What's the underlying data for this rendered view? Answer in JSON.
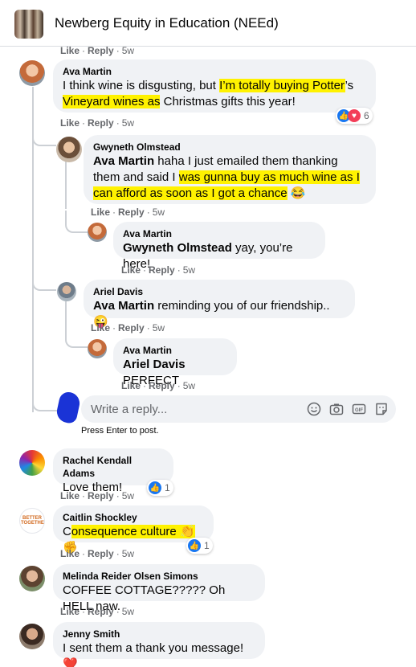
{
  "header": {
    "title": "Newberg Equity in Education (NEEd)"
  },
  "top_actions": {
    "like": "Like",
    "reply": "Reply",
    "time": "5w"
  },
  "comments": [
    {
      "author": "Ava Martin",
      "text_parts": [
        "I think wine is disgusting, but ",
        "I’m totally buying Potter",
        "’s ",
        "Vineyard wines as",
        " Christmas gifts this year!"
      ],
      "like": "Like",
      "reply": "Reply",
      "time": "5w",
      "reaction_count": "6"
    },
    {
      "author": "Gwyneth Olmstead",
      "mention": "Ava Martin",
      "text_parts": [
        " haha I just emailed them thanking them and said I ",
        "was gunna buy as much wine as I can afford as soon as I got a chance",
        " 😂"
      ],
      "like": "Like",
      "reply": "Reply",
      "time": "5w"
    },
    {
      "author": "Ava Martin",
      "mention": "Gwyneth Olmstead",
      "text": " yay, you’re here!",
      "like": "Like",
      "reply": "Reply",
      "time": "5w"
    },
    {
      "author": "Ariel Davis",
      "mention": "Ava Martin",
      "text": " reminding you of our friendship.. 😜",
      "like": "Like",
      "reply": "Reply",
      "time": "5w"
    },
    {
      "author": "Ava Martin",
      "mention": "Ariel Davis",
      "text": " PERFECT",
      "like": "Like",
      "reply": "Reply",
      "time": "5w"
    },
    {
      "author": "Rachel Kendall Adams",
      "text": "Love them!",
      "like": "Like",
      "reply": "Reply",
      "time": "5w",
      "reaction_count": "1"
    },
    {
      "author": "Caitlin Shockley",
      "text_parts": [
        "C",
        "onsequence culture 👏",
        "✊"
      ],
      "like": "Like",
      "reply": "Reply",
      "time": "5w",
      "reaction_count": "1",
      "avatar_text": "BETTER TOGETHER"
    },
    {
      "author": "Melinda Reider Olsen Simons",
      "text": "COFFEE COTTAGE????? Oh HELL naw.",
      "like": "Like",
      "reply": "Reply",
      "time": "5w"
    },
    {
      "author": "Jenny Smith",
      "text": "I sent them a thank you message! ❤️"
    }
  ],
  "reply_box": {
    "placeholder": "Write a reply...",
    "hint": "Press Enter to post."
  },
  "icons": [
    "emoji-icon",
    "camera-icon",
    "gif-icon",
    "sticker-icon"
  ],
  "colors": {
    "highlight": "#fff200",
    "bubble": "#f0f2f5",
    "like_blue": "#1877f2",
    "love_red": "#f33e58"
  }
}
